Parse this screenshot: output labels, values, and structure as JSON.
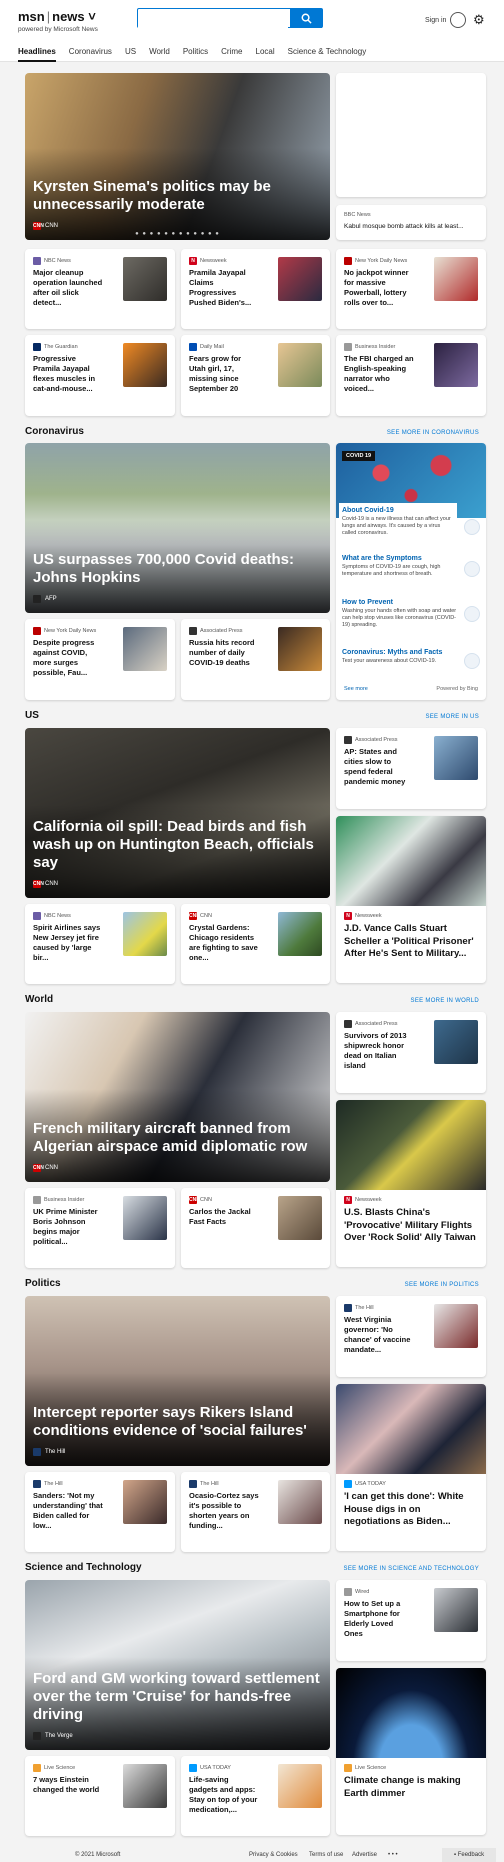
{
  "header": {
    "logo": "msn",
    "sep": "|",
    "product": "news",
    "powered": "powered by Microsoft News",
    "search_placeholder": "",
    "signin": "Sign in"
  },
  "nav": [
    "Headlines",
    "Coronavirus",
    "US",
    "World",
    "Politics",
    "Crime",
    "Local",
    "Science & Technology"
  ],
  "headlines": {
    "hero": {
      "title": "Kyrsten Sinema's politics may be unnecessarily moderate",
      "source": "CNN"
    },
    "side": {
      "source": "BBC News",
      "title": "Kabul mosque bomb attack kills at least..."
    },
    "row1": [
      {
        "source": "NBC News",
        "title": "Major cleanup operation launched after oil slick detect..."
      },
      {
        "source": "Newsweek",
        "title": "Pramila Jayapal Claims Progressives Pushed Biden's..."
      },
      {
        "source": "New York Daily News",
        "title": "No jackpot winner for massive Powerball, lottery rolls over to..."
      }
    ],
    "row2": [
      {
        "source": "The Guardian",
        "title": "Progressive Pramila Jayapal flexes muscles in cat-and-mouse..."
      },
      {
        "source": "Daily Mail",
        "title": "Fears grow for Utah girl, 17, missing since September 20"
      },
      {
        "source": "Business Insider",
        "title": "The FBI charged an English-speaking narrator who voiced..."
      }
    ]
  },
  "coronavirus": {
    "title": "Coronavirus",
    "see_more": "SEE MORE IN CORONAVIRUS",
    "hero": {
      "title": "US surpasses 700,000 Covid deaths: Johns Hopkins",
      "source": "AFP"
    },
    "row": [
      {
        "source": "New York Daily News",
        "title": "Despite progress against COVID, more surges possible, Fau..."
      },
      {
        "source": "Associated Press",
        "title": "Russia hits record number of daily COVID-19 deaths"
      }
    ],
    "widget": {
      "badge": "COVID 19",
      "items": [
        {
          "h": "About Covid-19",
          "d": "Covid-19 is a new illness that can affect your lungs and airways. It's caused by a virus called coronavirus."
        },
        {
          "h": "What are the Symptoms",
          "d": "Symptoms of COVID-19 are cough, high temperature and shortness of breath."
        },
        {
          "h": "How to Prevent",
          "d": "Washing your hands often with soap and water can help stop viruses like coronavirus (COVID-19) spreading."
        },
        {
          "h": "Coronavirus: Myths and Facts",
          "d": "Test your awareness about COVID-19."
        }
      ],
      "see_more": "See more",
      "powered": "Powered by Bing"
    }
  },
  "us": {
    "title": "US",
    "see_more": "SEE MORE IN US",
    "hero": {
      "title": "California oil spill: Dead birds and fish wash up on Huntington Beach, officials say",
      "source": "CNN"
    },
    "side": {
      "source": "Associated Press",
      "title": "AP: States and cities slow to spend federal pandemic money"
    },
    "tall": {
      "source": "Newsweek",
      "title": "J.D. Vance Calls Stuart Scheller a 'Political Prisoner' After He's Sent to Military..."
    },
    "row": [
      {
        "source": "NBC News",
        "title": "Spirit Airlines says New Jersey jet fire caused by 'large bir..."
      },
      {
        "source": "CNN",
        "title": "Crystal Gardens: Chicago residents are fighting to save one..."
      }
    ]
  },
  "world": {
    "title": "World",
    "see_more": "SEE MORE IN WORLD",
    "hero": {
      "title": "French military aircraft banned from Algerian airspace amid diplomatic row",
      "source": "CNN"
    },
    "side": {
      "source": "Associated Press",
      "title": "Survivors of 2013 shipwreck honor dead on Italian island"
    },
    "tall": {
      "source": "Newsweek",
      "title": "U.S. Blasts China's 'Provocative' Military Flights Over 'Rock Solid' Ally Taiwan"
    },
    "row": [
      {
        "source": "Business Insider",
        "title": "UK Prime Minister Boris Johnson begins major political..."
      },
      {
        "source": "CNN",
        "title": "Carlos the Jackal Fast Facts"
      }
    ]
  },
  "politics": {
    "title": "Politics",
    "see_more": "SEE MORE IN POLITICS",
    "hero": {
      "title": "Intercept reporter says Rikers Island conditions evidence of 'social failures'",
      "source": "The Hill"
    },
    "side": {
      "source": "The Hill",
      "title": "West Virginia governor: 'No chance' of vaccine mandate..."
    },
    "tall": {
      "source": "USA TODAY",
      "title": "'I can get this done': White House digs in on negotiations as Biden..."
    },
    "row": [
      {
        "source": "The Hill",
        "title": "Sanders: 'Not my understanding' that Biden called for low..."
      },
      {
        "source": "The Hill",
        "title": "Ocasio-Cortez says it's possible to shorten years on funding..."
      }
    ]
  },
  "science": {
    "title": "Science and Technology",
    "see_more": "SEE MORE IN SCIENCE AND TECHNOLOGY",
    "hero": {
      "title": "Ford and GM working toward settlement over the term 'Cruise' for hands-free driving",
      "source": "The Verge"
    },
    "side": {
      "source": "Wired",
      "title": "How to Set up a Smartphone for Elderly Loved Ones"
    },
    "tall": {
      "source": "Live Science",
      "title": "Climate change is making Earth dimmer"
    },
    "row": [
      {
        "source": "Live Science",
        "title": "7 ways Einstein changed the world"
      },
      {
        "source": "USA TODAY",
        "title": "Life-saving gadgets and apps: Stay on top of your medication,..."
      }
    ]
  },
  "footer": {
    "copyright": "© 2021 Microsoft",
    "links": [
      "Privacy & Cookies",
      "Terms of use",
      "Advertise"
    ],
    "more": "• • •",
    "feedback": "Feedback"
  }
}
